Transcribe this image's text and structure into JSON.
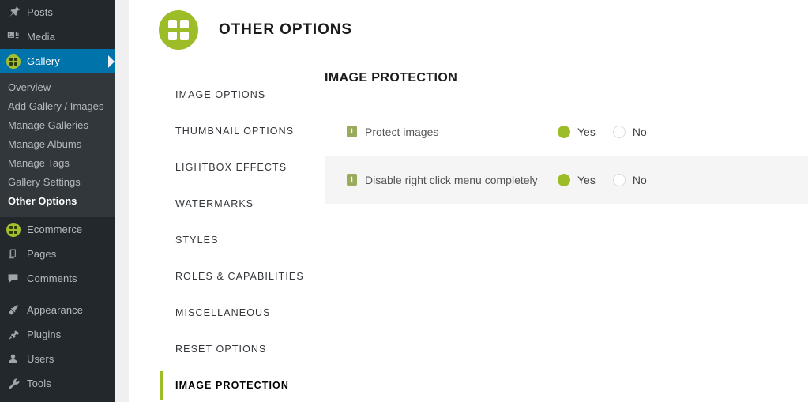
{
  "colors": {
    "brand_green": "#9cbd28",
    "info_icon_green": "#9aab5e",
    "admin_blue": "#0073aa",
    "admin_dark": "#23282d",
    "admin_submenu": "#32373c",
    "row_alt": "#f5f5f5"
  },
  "sidebar": {
    "items": [
      {
        "label": "Posts",
        "icon": "pin-icon",
        "current": false
      },
      {
        "label": "Media",
        "icon": "media-icon",
        "current": false
      },
      {
        "label": "Gallery",
        "icon": "gallery-grid-icon",
        "current": true
      }
    ],
    "submenu": [
      {
        "label": "Overview",
        "current": false
      },
      {
        "label": "Add Gallery / Images",
        "current": false
      },
      {
        "label": "Manage Galleries",
        "current": false
      },
      {
        "label": "Manage Albums",
        "current": false
      },
      {
        "label": "Manage Tags",
        "current": false
      },
      {
        "label": "Gallery Settings",
        "current": false
      },
      {
        "label": "Other Options",
        "current": true
      }
    ],
    "items_lower": [
      {
        "label": "Ecommerce",
        "icon": "ecommerce-grid-icon",
        "current": false
      },
      {
        "label": "Pages",
        "icon": "pages-icon",
        "current": false
      },
      {
        "label": "Comments",
        "icon": "comments-icon",
        "current": false
      }
    ],
    "items_bottom": [
      {
        "label": "Appearance",
        "icon": "appearance-brush-icon",
        "current": false
      },
      {
        "label": "Plugins",
        "icon": "plugins-plug-icon",
        "current": false
      },
      {
        "label": "Users",
        "icon": "users-icon",
        "current": false
      },
      {
        "label": "Tools",
        "icon": "tools-wrench-icon",
        "current": false
      }
    ]
  },
  "header": {
    "title": "OTHER OPTIONS",
    "logo_icon": "four-squares-grid-icon"
  },
  "tabs": [
    {
      "label": "IMAGE OPTIONS",
      "active": false
    },
    {
      "label": "THUMBNAIL OPTIONS",
      "active": false
    },
    {
      "label": "LIGHTBOX EFFECTS",
      "active": false
    },
    {
      "label": "WATERMARKS",
      "active": false
    },
    {
      "label": "STYLES",
      "active": false
    },
    {
      "label": "ROLES & CAPABILITIES",
      "active": false
    },
    {
      "label": "MISCELLANEOUS",
      "active": false
    },
    {
      "label": "RESET OPTIONS",
      "active": false
    },
    {
      "label": "IMAGE PROTECTION",
      "active": true
    }
  ],
  "settings": {
    "section_title": "IMAGE PROTECTION",
    "info_glyph": "i",
    "rows": [
      {
        "label": "Protect images",
        "options": [
          {
            "label": "Yes",
            "checked": true
          },
          {
            "label": "No",
            "checked": false
          }
        ]
      },
      {
        "label": "Disable right click menu completely",
        "options": [
          {
            "label": "Yes",
            "checked": true
          },
          {
            "label": "No",
            "checked": false
          }
        ]
      }
    ]
  }
}
